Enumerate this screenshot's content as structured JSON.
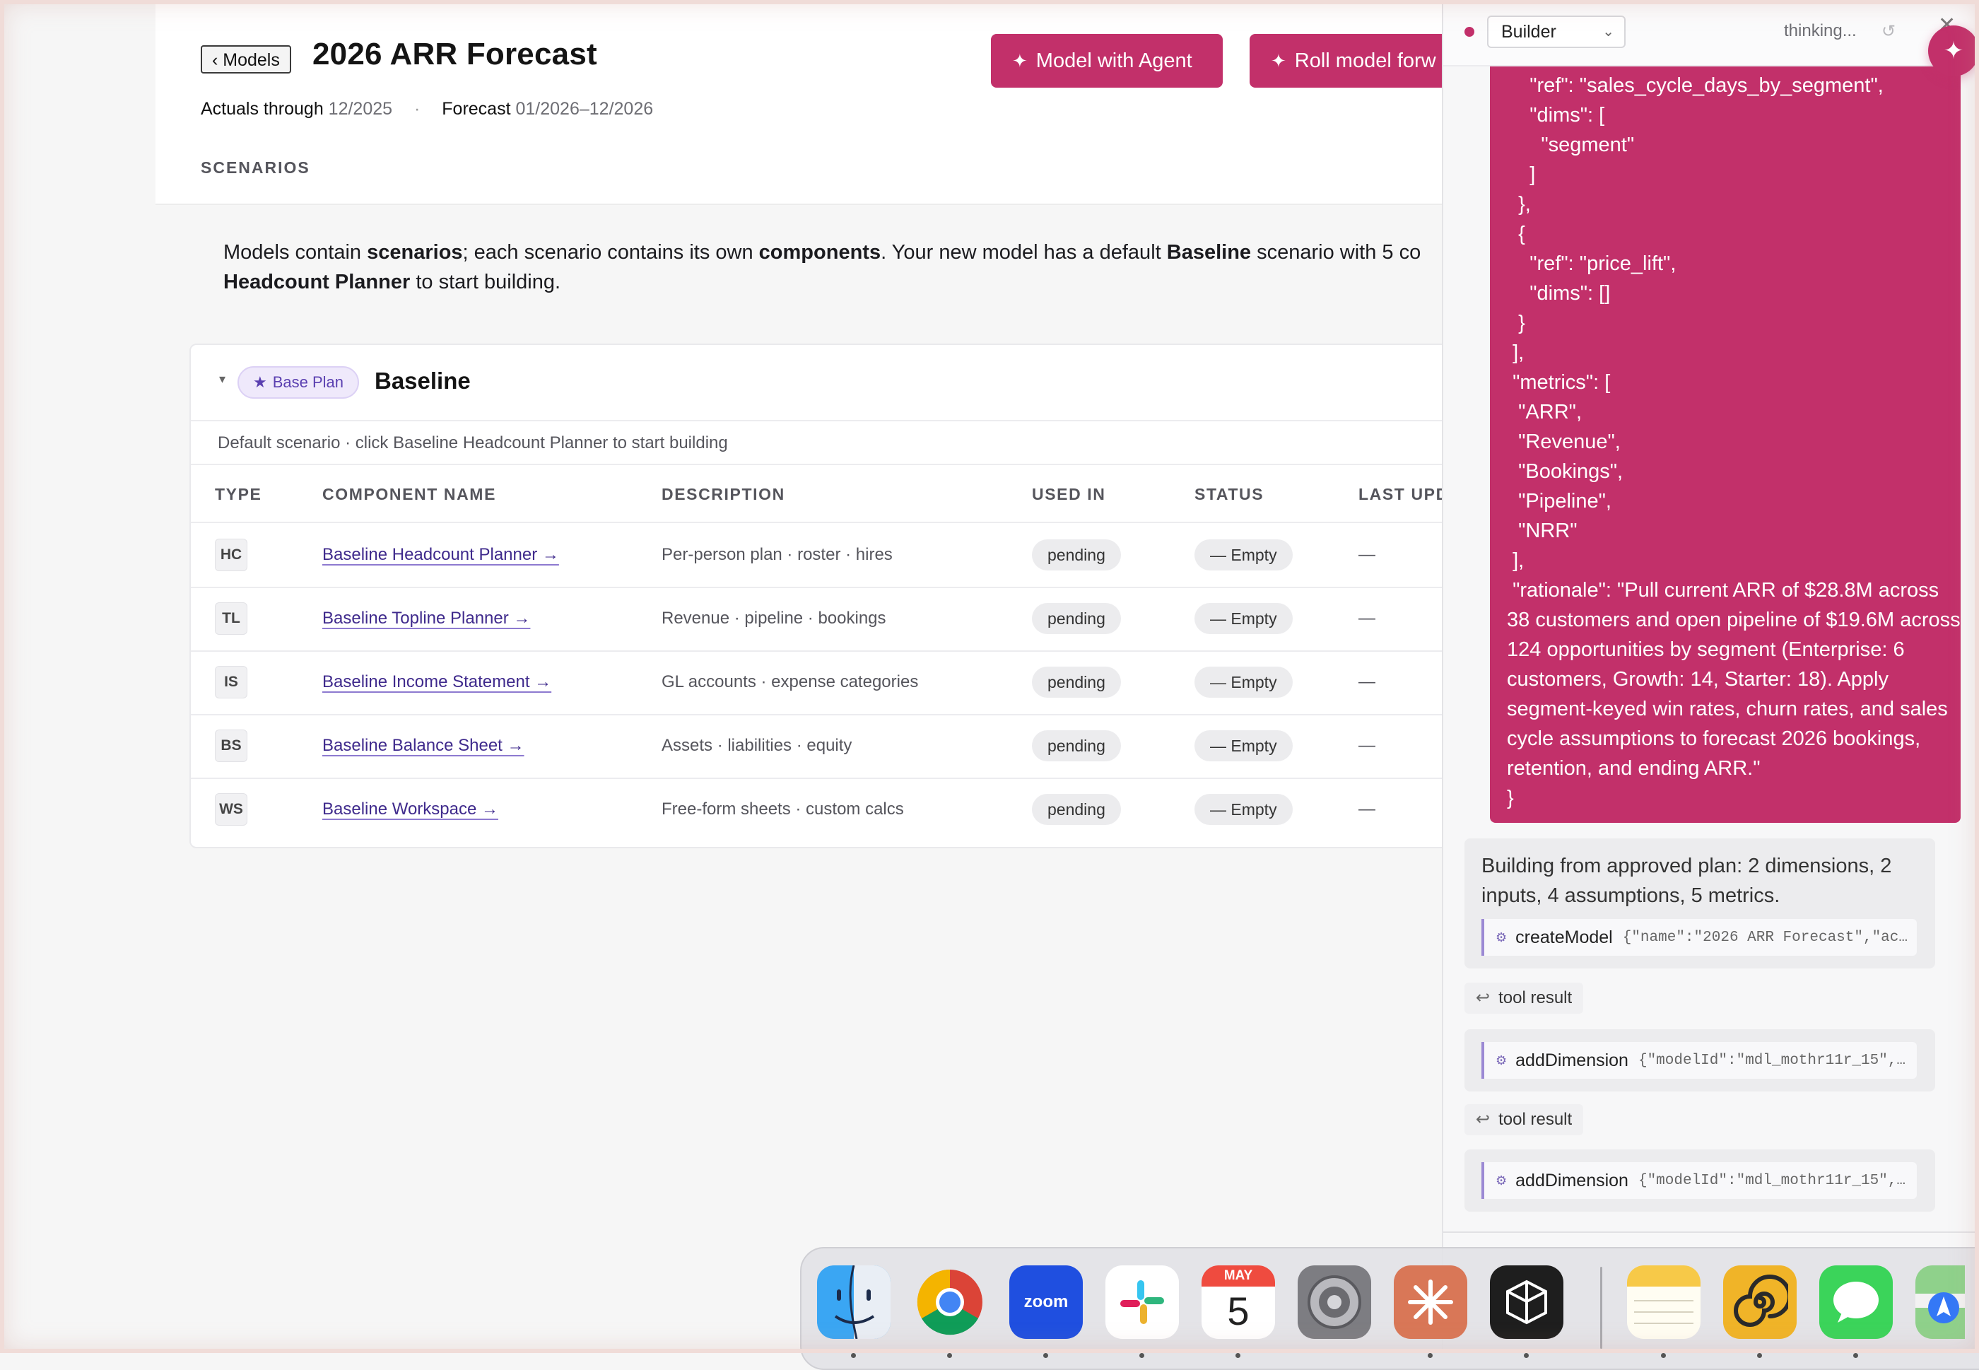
{
  "header": {
    "back_label": "‹ Models",
    "title": "2026 ARR Forecast",
    "actuals_label": "Actuals through",
    "actuals_value": "12/2025",
    "forecast_label": "Forecast",
    "forecast_value": "01/2026–12/2026",
    "separator": "·",
    "scenarios_label": "SCENARIOS",
    "btn_agent": "Model with Agent",
    "btn_roll": "Roll model forw",
    "spark": "✦"
  },
  "intro": {
    "p1": "Models contain ",
    "b1": "scenarios",
    "p2": "; each scenario contains its own ",
    "b2": "components",
    "p3": ". Your new model has a default ",
    "b3": "Baseline",
    "p4": " scenario with 5 co",
    "b4": "Headcount Planner",
    "p5": " to start building."
  },
  "scenario": {
    "caret": "▾",
    "badge_star": "★",
    "badge_label": "Base Plan",
    "name": "Baseline",
    "subtitle": "Default scenario · click Baseline Headcount Planner to start building",
    "columns": [
      "TYPE",
      "COMPONENT NAME",
      "DESCRIPTION",
      "USED IN",
      "STATUS",
      "LAST UPD"
    ],
    "rows": [
      {
        "type": "HC",
        "name": "Baseline Headcount Planner →",
        "desc": "Per-person plan · roster · hires",
        "used": "pending",
        "status": "— Empty",
        "last": "—"
      },
      {
        "type": "TL",
        "name": "Baseline Topline Planner →",
        "desc": "Revenue · pipeline · bookings",
        "used": "pending",
        "status": "— Empty",
        "last": "—"
      },
      {
        "type": "IS",
        "name": "Baseline Income Statement →",
        "desc": "GL accounts · expense categories",
        "used": "pending",
        "status": "— Empty",
        "last": "—"
      },
      {
        "type": "BS",
        "name": "Baseline Balance Sheet →",
        "desc": "Assets · liabilities · equity",
        "used": "pending",
        "status": "— Empty",
        "last": "—"
      },
      {
        "type": "WS",
        "name": "Baseline Workspace →",
        "desc": "Free-form sheets · custom calcs",
        "used": "pending",
        "status": "— Empty",
        "last": "—"
      }
    ]
  },
  "panel": {
    "mode": "Builder",
    "mode_chevron": "⌄",
    "status": "thinking...",
    "refresh": "↺",
    "close": "✕",
    "fab": "✦",
    "json_text": "    \"ref\": \"sales_cycle_days_by_segment\",\n    \"dims\": [\n      \"segment\"\n    ]\n  },\n  {\n    \"ref\": \"price_lift\",\n    \"dims\": []\n  }\n ],\n \"metrics\": [\n  \"ARR\",\n  \"Revenue\",\n  \"Bookings\",\n  \"Pipeline\",\n  \"NRR\"\n ],\n \"rationale\": \"Pull current ARR of $28.8M across 38 customers and open pipeline of $19.6M across 124 opportunities by segment (Enterprise: 6 customers, Growth: 14, Starter: 18). Apply segment-keyed win rates, churn rates, and sales cycle assumptions to forecast 2026 bookings, retention, and ending ARR.\"\n}",
    "plan_text": "Building from approved plan: 2 dimensions, 2 inputs, 4 assumptions, 5 metrics.",
    "gear": "⚙",
    "ret": "↩",
    "calls": [
      {
        "fn": "createModel",
        "args": "{\"name\":\"2026 ARR Forecast\",\"ac…"
      },
      {
        "fn": "addDimension",
        "args": "{\"modelId\":\"mdl_mothr11r_15\",…"
      },
      {
        "fn": "addDimension",
        "args": "{\"modelId\":\"mdl_mothr11r_15\",…"
      }
    ],
    "tool_result": "tool result"
  },
  "dock": {
    "calendar_month": "MAY",
    "calendar_day": "5",
    "zoom_label": "zoom",
    "apps": [
      "finder-icon",
      "chrome-icon",
      "zoom-icon",
      "slack-icon",
      "calendar-icon",
      "system-settings-icon",
      "claude-icon",
      "perplexity-icon",
      "notes-icon",
      "spiral-app-icon",
      "messages-icon",
      "maps-icon"
    ]
  }
}
